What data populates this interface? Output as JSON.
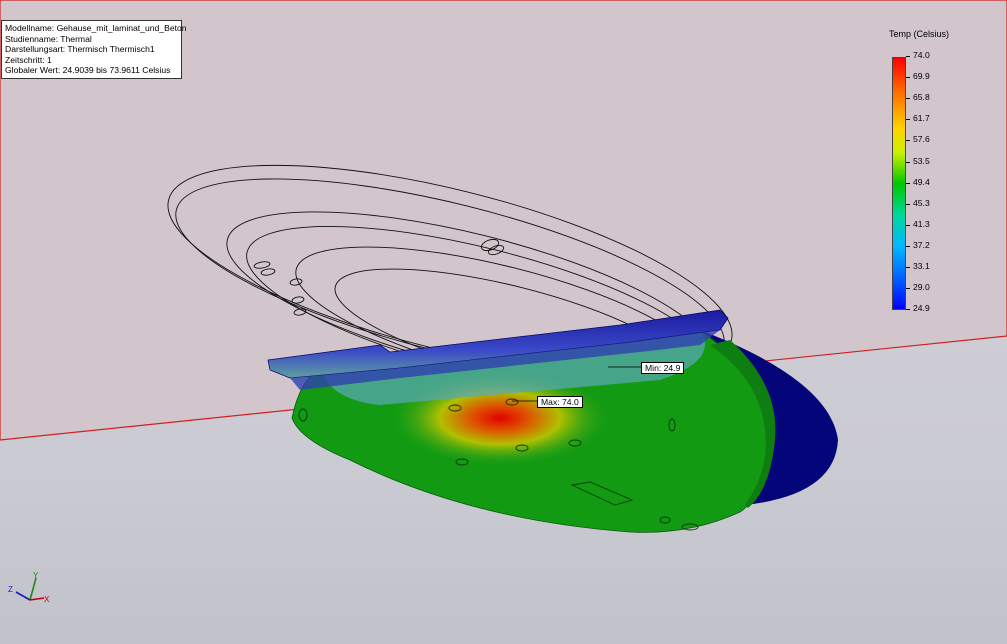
{
  "study_info": {
    "model_name": "Modellname: Gehause_mit_laminat_und_Beton",
    "study_name": "Studienname: Thermal",
    "plot_type": "Darstellungsart: Thermisch Thermisch1",
    "time_step": "Zeitschritt: 1",
    "global_value": "Globaler Wert: 24.9039 bis 73.9611 Celsius"
  },
  "legend": {
    "title": "Temp (Celsius)",
    "ticks": [
      "74.0",
      "69.9",
      "65.8",
      "61.7",
      "57.6",
      "53.5",
      "49.4",
      "45.3",
      "41.3",
      "37.2",
      "33.1",
      "29.0",
      "24.9"
    ],
    "colors": {
      "max": "#ff0000",
      "mid": "#00c800",
      "min": "#0000ff"
    }
  },
  "probes": {
    "min_label": "Min: 24.9",
    "max_label": "Max: 74.0"
  },
  "triad": {
    "x": "X",
    "y": "Y",
    "z": "Z"
  }
}
